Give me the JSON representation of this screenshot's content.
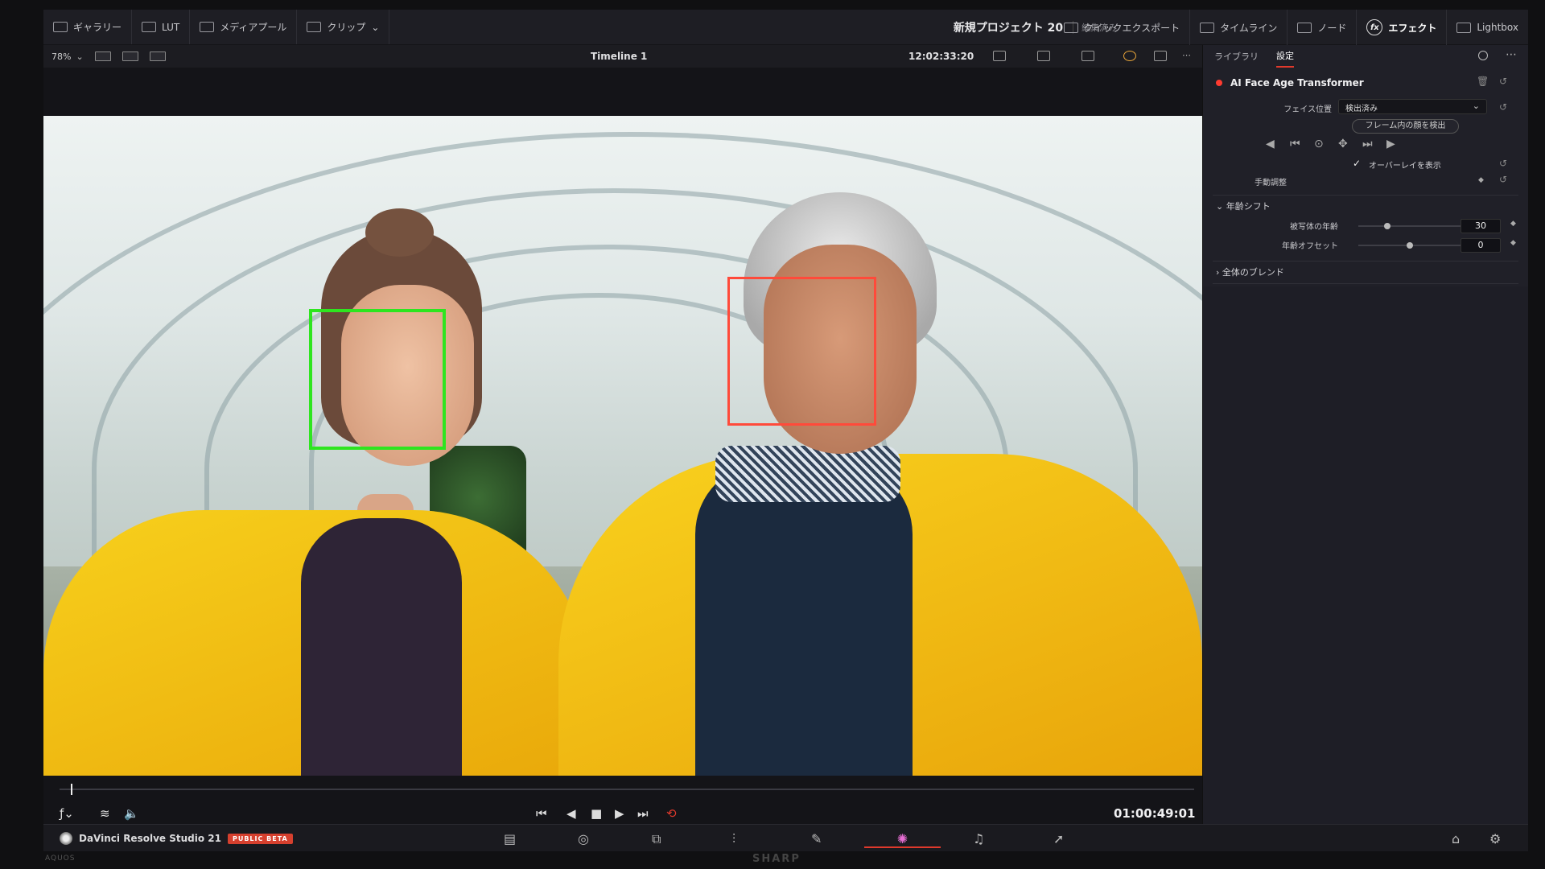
{
  "monitor": {
    "brand_left": "AQUOS",
    "brand_center": "SHARP"
  },
  "topbar": {
    "items": [
      "ギャラリー",
      "LUT",
      "メディアプール",
      "クリップ"
    ],
    "project_title": "新規プロジェクト 20",
    "project_status": "編集済み",
    "right_items": [
      "クイックエクスポート",
      "タイムライン",
      "ノード",
      "エフェクト",
      "Lightbox"
    ]
  },
  "viewer": {
    "zoom": "78%",
    "timeline_name": "Timeline 1",
    "timecode_top": "12:02:33:20",
    "timecode_bottom": "01:00:49:01",
    "playhead_position": 0.01
  },
  "brand": {
    "app_name": "DaVinci Resolve Studio 21",
    "badge": "PUBLIC BETA"
  },
  "panel": {
    "tabs": [
      "ライブラリ",
      "設定"
    ],
    "active_tab": "設定",
    "effect_name": "AI Face Age Transformer",
    "face_position_label": "フェイス位置",
    "face_position_value": "検出済み",
    "detect_button": "フレーム内の顔を検出",
    "overlay_label": "オーバーレイを表示",
    "overlay_checked": true,
    "manual_label": "手動調整",
    "section_age": "年齢シフト",
    "subject_age_label": "被写体の年齢",
    "subject_age_value": "30",
    "age_offset_label": "年齢オフセット",
    "age_offset_value": "0",
    "section_blend": "全体のブレンド"
  },
  "colors": {
    "accent": "#e0392c",
    "face_box_selected": "#2ee51f",
    "face_box_other": "#ff4a3a"
  }
}
